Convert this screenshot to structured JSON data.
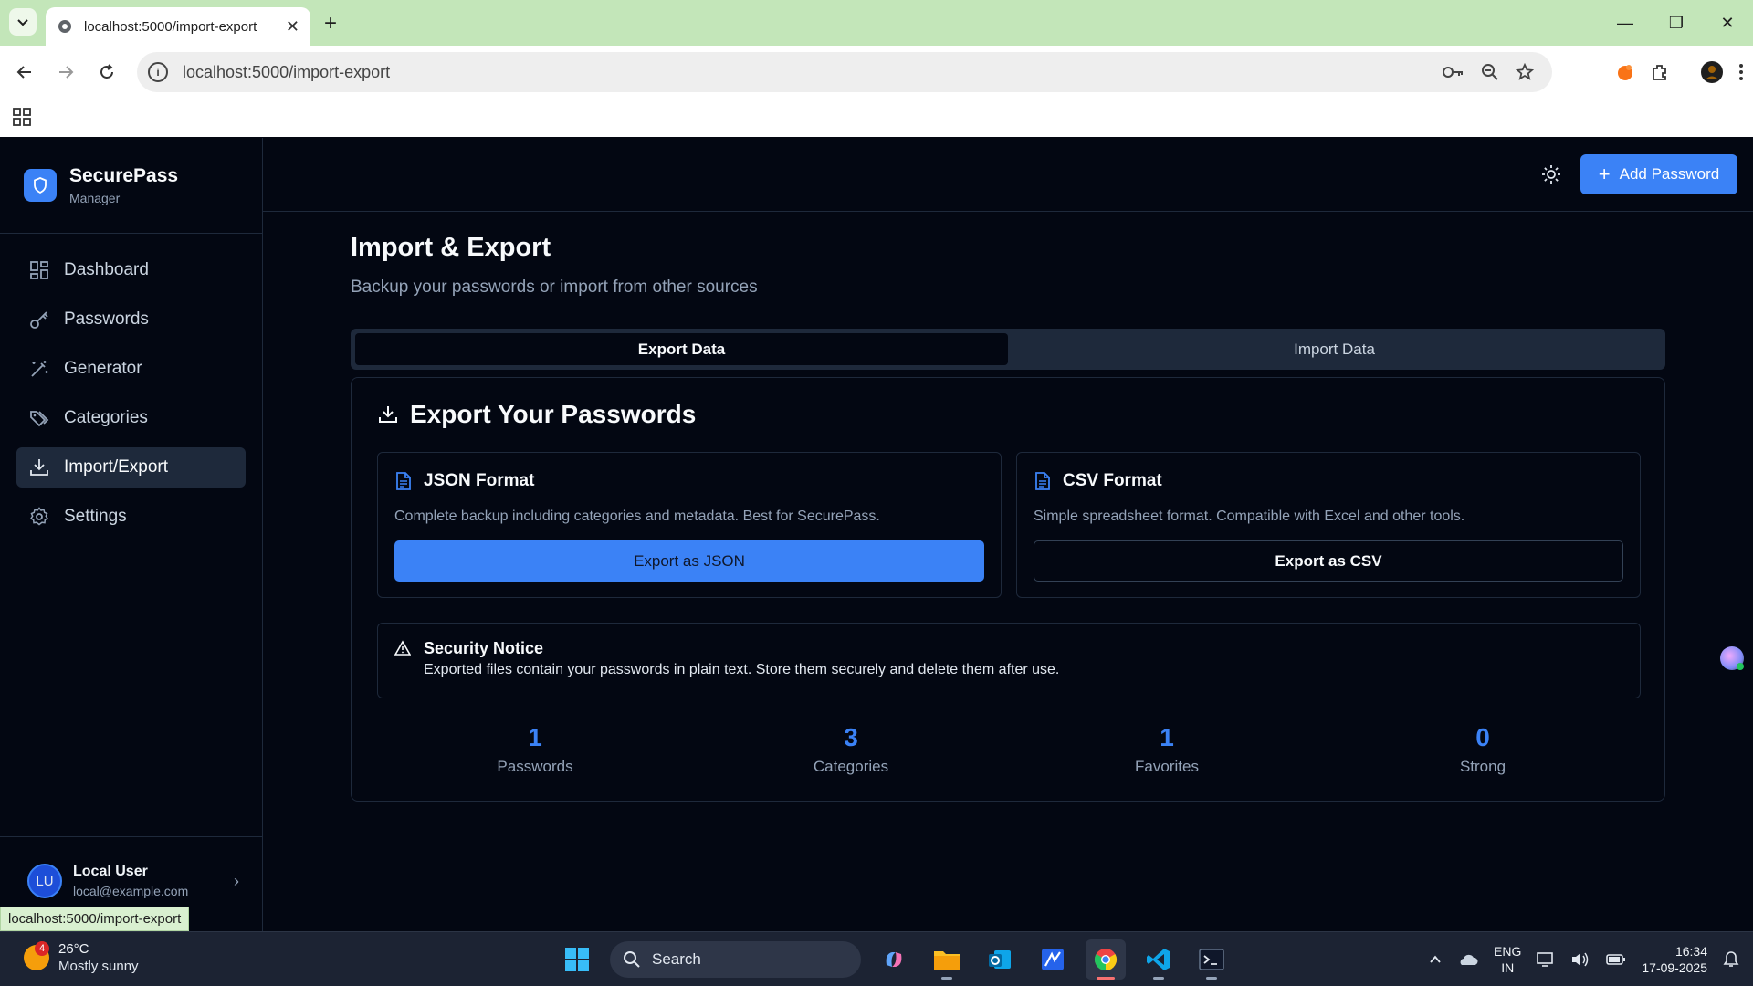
{
  "browser": {
    "tab_title": "localhost:5000/import-export",
    "url": "localhost:5000/import-export",
    "status_url": "localhost:5000/import-export"
  },
  "brand": {
    "name": "SecurePass",
    "subtitle": "Manager"
  },
  "sidebar": {
    "items": [
      {
        "label": "Dashboard",
        "icon": "dashboard-icon",
        "active": false
      },
      {
        "label": "Passwords",
        "icon": "key-icon",
        "active": false
      },
      {
        "label": "Generator",
        "icon": "magic-wand-icon",
        "active": false
      },
      {
        "label": "Categories",
        "icon": "tags-icon",
        "active": false
      },
      {
        "label": "Import/Export",
        "icon": "download-icon",
        "active": true
      },
      {
        "label": "Settings",
        "icon": "gear-icon",
        "active": false
      }
    ],
    "user": {
      "initials": "LU",
      "name": "Local User",
      "email": "local@example.com"
    }
  },
  "topbar": {
    "add_label": "Add Password"
  },
  "page": {
    "title": "Import & Export",
    "subtitle": "Backup your passwords or import from other sources",
    "tabs": [
      "Export Data",
      "Import Data"
    ],
    "active_tab": "Export Data"
  },
  "export": {
    "title": "Export Your Passwords",
    "json": {
      "title": "JSON Format",
      "description": "Complete backup including categories and metadata. Best for SecurePass.",
      "button": "Export as JSON"
    },
    "csv": {
      "title": "CSV Format",
      "description": "Simple spreadsheet format. Compatible with Excel and other tools.",
      "button": "Export as CSV"
    },
    "notice": {
      "title": "Security Notice",
      "body": "Exported files contain your passwords in plain text. Store them securely and delete them after use."
    },
    "stats": [
      {
        "value": "1",
        "label": "Passwords"
      },
      {
        "value": "3",
        "label": "Categories"
      },
      {
        "value": "1",
        "label": "Favorites"
      },
      {
        "value": "0",
        "label": "Strong"
      }
    ]
  },
  "taskbar": {
    "weather_temp": "26°C",
    "weather_cond": "Mostly sunny",
    "weather_badge": "4",
    "search_label": "Search",
    "lang_top": "ENG",
    "lang_bottom": "IN",
    "time": "16:34",
    "date": "17-09-2025"
  },
  "colors": {
    "accent": "#3b82f6",
    "background": "#030712",
    "border": "#1e293b"
  }
}
